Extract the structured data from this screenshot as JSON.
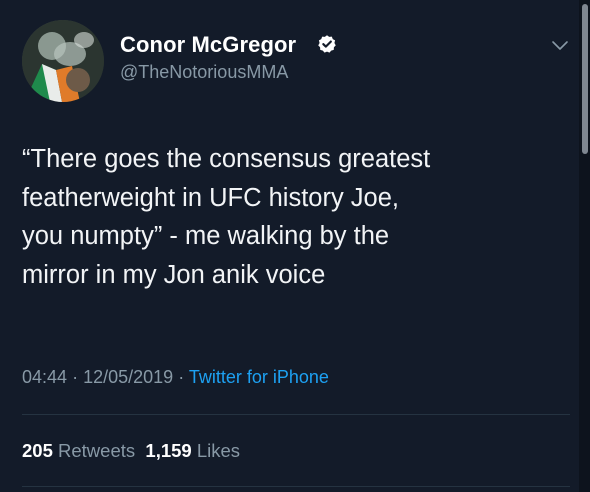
{
  "user": {
    "display_name": "Conor McGregor",
    "handle": "@TheNotoriousMMA",
    "verified": true
  },
  "tweet": {
    "text": "“There goes the consensus greatest\nfeatherweight in UFC history Joe,\nyou numpty” - me walking by the\nmirror in my Jon anik voice",
    "time": "04:44",
    "date": "12/05/2019",
    "separator": "·",
    "source": "Twitter for iPhone"
  },
  "stats": {
    "retweets_count": "205",
    "retweets_label": "Retweets",
    "likes_count": "1,159",
    "likes_label": "Likes"
  },
  "colors": {
    "background": "#131b29",
    "primary_text": "#ffffff",
    "secondary_text": "#8899a6",
    "link": "#1da1f2",
    "divider": "#253341"
  },
  "icons": {
    "verified": "verified-badge-icon",
    "menu": "chevron-down-icon"
  }
}
